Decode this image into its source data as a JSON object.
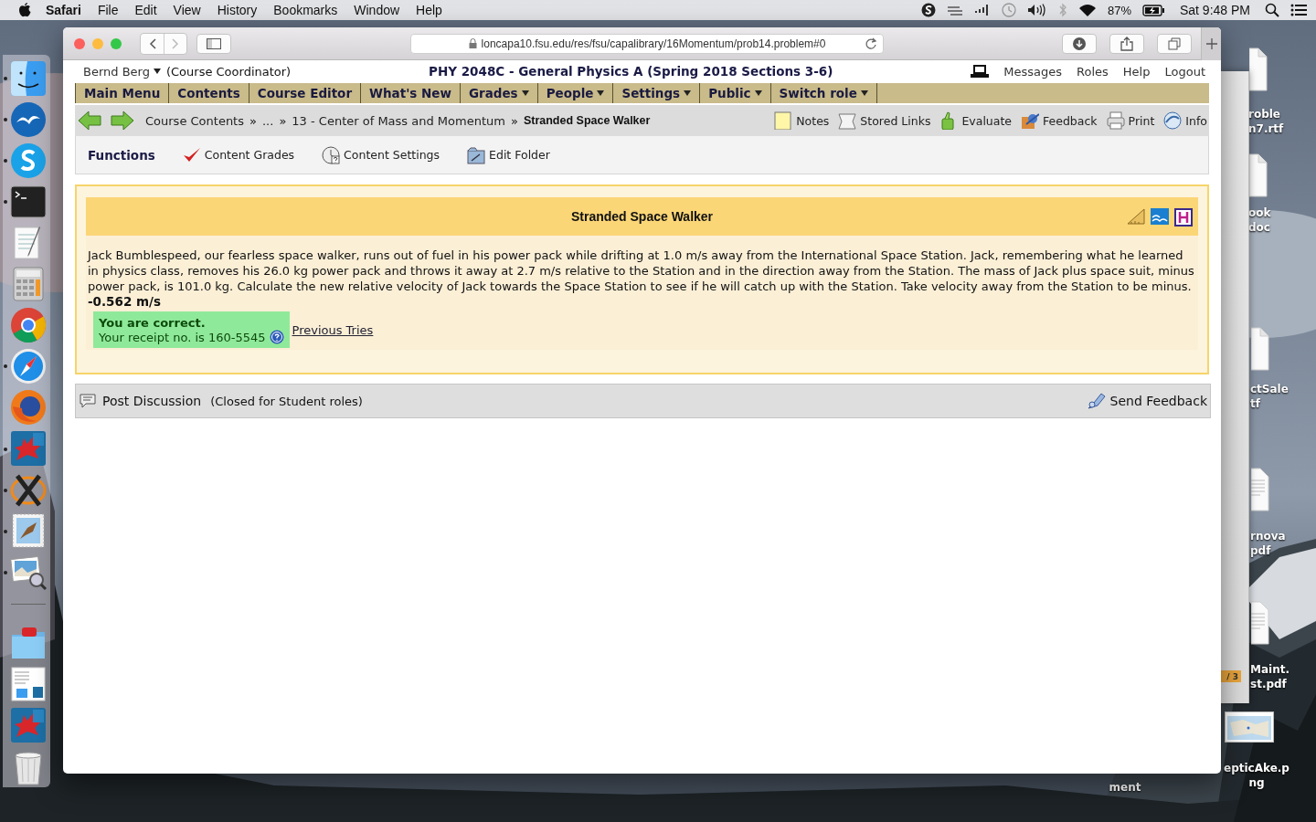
{
  "menu_bar": {
    "app": "Safari",
    "menus": [
      "File",
      "Edit",
      "View",
      "History",
      "Bookmarks",
      "Window",
      "Help"
    ],
    "battery": "87%",
    "clock": "Sat 9:48 PM"
  },
  "dock": {
    "items": [
      {
        "kind": "finder",
        "running": true
      },
      {
        "kind": "office",
        "running": true
      },
      {
        "kind": "chat",
        "running": true
      },
      {
        "kind": "terminal",
        "running": true
      },
      {
        "kind": "textedit",
        "running": false
      },
      {
        "kind": "calculator",
        "running": false
      },
      {
        "kind": "chrome",
        "running": false
      },
      {
        "kind": "compass",
        "running": true
      },
      {
        "kind": "firefox",
        "running": false
      },
      {
        "kind": "maple",
        "running": true
      },
      {
        "kind": "xwin",
        "running": true
      },
      {
        "kind": "mail",
        "running": true
      },
      {
        "kind": "preview",
        "running": true
      },
      {
        "kind": "separator"
      },
      {
        "kind": "folder",
        "running": false
      },
      {
        "kind": "stack",
        "running": false
      },
      {
        "kind": "maple",
        "running": false
      },
      {
        "kind": "trash",
        "running": false
      }
    ]
  },
  "browser": {
    "url": "loncapa10.fsu.edu/res/fsu/capalibrary/16Momentum/prob14.problem#0"
  },
  "page": {
    "user": "Bernd Berg",
    "role": "(Course Coordinator)",
    "course_title": "PHY 2048C - General Physics A (Spring 2018 Sections 3-6)",
    "header_links": [
      "Messages",
      "Roles",
      "Help",
      "Logout"
    ],
    "main_menu": [
      {
        "label": "Main Menu",
        "dropdown": false
      },
      {
        "label": "Contents",
        "dropdown": false
      },
      {
        "label": "Course Editor",
        "dropdown": false
      },
      {
        "label": "What's New",
        "dropdown": false
      },
      {
        "label": "Grades",
        "dropdown": true
      },
      {
        "label": "People",
        "dropdown": true
      },
      {
        "label": "Settings",
        "dropdown": true
      },
      {
        "label": "Public",
        "dropdown": true
      },
      {
        "label": "Switch role",
        "dropdown": true
      }
    ],
    "breadcrumb": [
      "Course Contents",
      "...",
      "13 - Center of Mass and Momentum",
      "Stranded Space Walker"
    ],
    "breadcrumb_separator": "»",
    "tools": [
      {
        "label": "Notes",
        "kind": "notes"
      },
      {
        "label": "Stored Links",
        "kind": "links"
      },
      {
        "label": "Evaluate",
        "kind": "evaluate"
      },
      {
        "label": "Feedback",
        "kind": "feedback"
      },
      {
        "label": "Print",
        "kind": "print"
      },
      {
        "label": "Info",
        "kind": "info"
      }
    ],
    "functions": {
      "title": "Functions",
      "items": [
        {
          "label": "Content Grades",
          "kind": "grades"
        },
        {
          "label": "Content Settings",
          "kind": "settings"
        },
        {
          "label": "Edit Folder",
          "kind": "folder"
        }
      ]
    },
    "problem": {
      "title": "Stranded Space Walker",
      "text": "Jack Bumblespeed, our fearless space walker, runs out of fuel in his power pack while drifting at 1.0 m/s away from the International Space Station. Jack, remembering what he learned in physics class, removes his 26.0 kg power pack and throws it away at 2.7 m/s relative to the Station and in the direction away from the Station. The mass of Jack plus space suit, minus power pack, is 101.0 kg. Calculate the new relative velocity of Jack towards the Space Station to see if he will catch up with the Station. Take velocity away from the Station to be minus.",
      "answer": "-0.562 m/s",
      "result_title": "You are correct.",
      "receipt": "Your receipt no. is 160-5545",
      "previous_tries": "Previous Tries"
    },
    "discussion": {
      "post": "Post Discussion",
      "note": "(Closed for Student roles)",
      "feedback": "Send Feedback"
    }
  },
  "desktop": {
    "badge": "/ 3",
    "files": [
      {
        "kind": "document",
        "lines": [
          "roble",
          "n7.rtf"
        ]
      },
      {
        "kind": "document",
        "lines": [
          "ook",
          "doc"
        ]
      },
      {
        "kind": "document",
        "lines": [
          "ctSale",
          "tf"
        ]
      },
      {
        "kind": "pdf",
        "lines": [
          "rnova",
          "pdf"
        ]
      },
      {
        "kind": "pdf",
        "lines": [
          "Maint.",
          "st.pdf"
        ]
      },
      {
        "kind": "label",
        "lines": [
          "ment"
        ]
      },
      {
        "lines": [
          "epticAke.p",
          "ng"
        ]
      }
    ]
  }
}
